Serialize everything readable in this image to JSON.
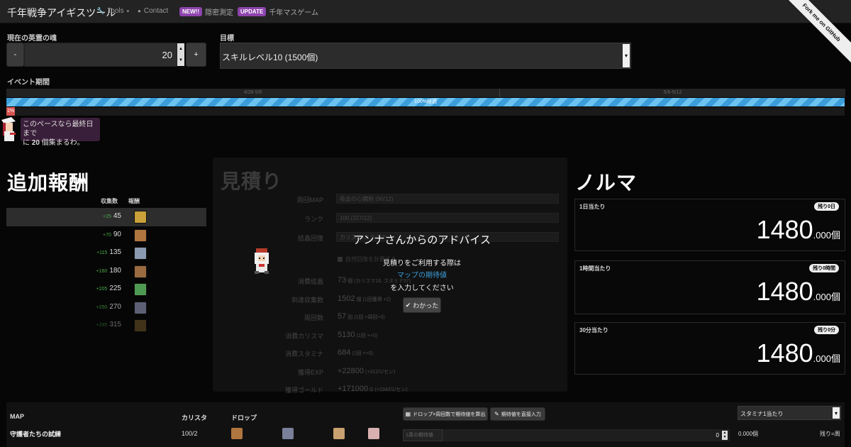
{
  "nav": {
    "brand": "千年戦争アイギスツール",
    "tools": "Tools",
    "contact": "Contact",
    "new_badge": "NEW!!",
    "new_label": "隠密測定",
    "update_badge": "UPDATE",
    "update_label": "千年マスゲーム",
    "ribbon": "Fork me on GitHub"
  },
  "form": {
    "current_label": "現在の英霊の魂",
    "minus": "-",
    "current_value": "20",
    "plus": "+",
    "goal_label": "目標",
    "goal_value": "スキルレベル10 (1500個)"
  },
  "event": {
    "label": "イベント期間",
    "period_1": "4/28-5/6",
    "period_2": "5/6-5/12",
    "progress_text": "100%経過",
    "progress_percent": 100,
    "collected_text": "1%",
    "collected_percent": 1,
    "advice_line1": "このペースなら最終日まで",
    "advice_prefix": "に ",
    "advice_count": "20",
    "advice_suffix": " 個集まるわ。"
  },
  "reward": {
    "title": "追加報酬",
    "col_count": "収集数",
    "col_reward": "報酬",
    "rows": [
      {
        "plus": "+25",
        "count": "45",
        "icon": "gold-reward-icon",
        "color": "#c9a03a"
      },
      {
        "plus": "+70",
        "count": "90",
        "icon": "bronze-unit-icon",
        "color": "#b07640"
      },
      {
        "plus": "+115",
        "count": "135",
        "icon": "silver-unit-icon",
        "color": "#8a9ab0"
      },
      {
        "plus": "+160",
        "count": "180",
        "icon": "brown-unit-icon",
        "color": "#9a6a40"
      },
      {
        "plus": "+205",
        "count": "225",
        "icon": "green-spirit-icon",
        "color": "#4f9a52"
      },
      {
        "plus": "+250",
        "count": "270",
        "icon": "platinum-unit-icon",
        "color": "#7a7f9a"
      },
      {
        "plus": "+295",
        "count": "315",
        "icon": "gold-unit-icon",
        "color": "#8a6a30"
      }
    ]
  },
  "estimate": {
    "title": "見積り",
    "map_label": "周回MAP",
    "map_value": "吸血の心臓剣 (90/12)",
    "rank_label": "ランク",
    "rank_value": "100 (327/12)",
    "crystal_label": "結晶回復",
    "crystal_value": "カリスマ/スタミナ",
    "natural_label": "自然回復を計算する",
    "rows": [
      {
        "label": "消費結晶",
        "value": "73",
        "sub": "個 (カリスマ16, スタミナ57)"
      },
      {
        "label": "到達収集数",
        "value": "1502",
        "sub": "個 (1回獲得 +2)"
      },
      {
        "label": "周回数",
        "value": "57",
        "sub": "回 (1回 ×周回+0)"
      },
      {
        "label": "消費カリスマ",
        "value": "5130",
        "sub": "(1回 ×+0)"
      },
      {
        "label": "消費スタミナ",
        "value": "684",
        "sub": "(1回 ×+0)"
      },
      {
        "label": "獲得EXP",
        "value": "+22800",
        "sub": "(+312/1/セン)"
      },
      {
        "label": "獲得ゴールド",
        "value": "+171000",
        "sub": "G (+2342/1/セン)"
      }
    ]
  },
  "modal": {
    "title": "アンナさんからのアドバイス",
    "line1": "見積りをご利用する際は",
    "link": "マップの期待値",
    "line2": "を入力してください",
    "ok": "わかった"
  },
  "quota": {
    "title": "ノルマ",
    "cards": [
      {
        "label": "1日当たり",
        "pill": "残り0日",
        "value": "1480",
        "decimal": ".000",
        "unit": "個"
      },
      {
        "label": "1時間当たり",
        "pill": "残り0時間",
        "value": "1480",
        "decimal": ".000",
        "unit": "個"
      },
      {
        "label": "30分当たり",
        "pill": "残り0分",
        "value": "1480",
        "decimal": ".000",
        "unit": "個"
      }
    ]
  },
  "map_table": {
    "col_map": "MAP",
    "col_charisma": "カリスタ",
    "col_drop": "ドロップ",
    "calc_button": "ドロップ×周回数で期待値を算出",
    "direct_button": "期待値を直接入力",
    "select_value": "スタミナ1当たり",
    "row": {
      "map": "守護者たちの試練",
      "charisma": "100/2",
      "expected_placeholder": "1周の期待値",
      "expected_value": "0",
      "result": "0.000個",
      "remain": "残り=周"
    }
  },
  "colors": {
    "new_badge": "#8e44ad",
    "update_badge": "#8e44ad",
    "progress": "#3b9dd9",
    "collected": "#d9534f",
    "advice_bg": "#3a1f3a",
    "link": "#3b9dd9"
  }
}
